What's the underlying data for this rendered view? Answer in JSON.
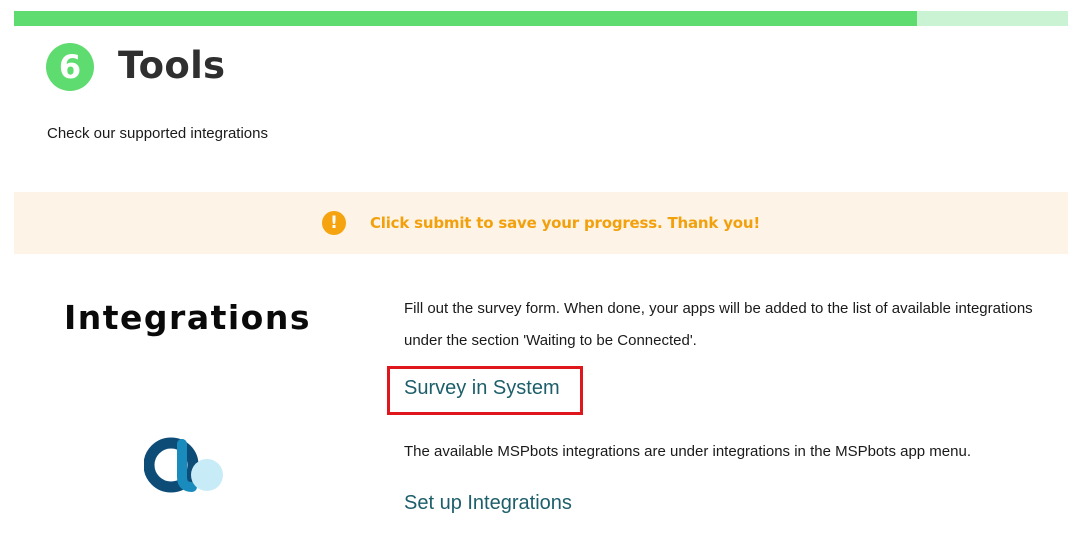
{
  "progress": {
    "fraction": 0.857
  },
  "step": {
    "number": "6",
    "title": "Tools"
  },
  "subtitle": "Check our supported integrations",
  "notice": {
    "icon": "exclamation-icon",
    "text": "Click submit to save your progress. Thank you!"
  },
  "integrations": {
    "title": "Integrations",
    "description1": "Fill out the survey form. When done, your apps will be added to the list of available integrations under the section 'Waiting to be Connected'.",
    "survey_link": "Survey in System",
    "description2": "The available MSPbots integrations are under integrations in the MSPbots app menu.",
    "setup_link": "Set up Integrations"
  },
  "colors": {
    "accent_green": "#5fdc6f",
    "notice_orange": "#f2a10d",
    "link_teal": "#1d5e6b",
    "highlight_red": "#e0161d"
  }
}
